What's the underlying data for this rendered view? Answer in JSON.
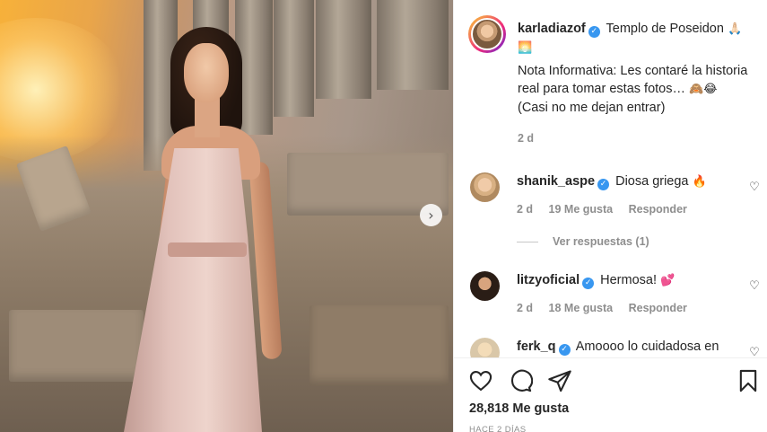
{
  "post": {
    "author": "karladiazof",
    "caption_title": "Templo de Poseidon",
    "caption_title_emoji": "🙏🏻🌅",
    "caption_body": "Nota Informativa: Les contaré la historia real para tomar estas fotos…",
    "caption_body_emoji": "🙈😂",
    "caption_footer": "(Casi no me dejan entrar)",
    "age": "2 d"
  },
  "comments": [
    {
      "author": "shanik_aspe",
      "text": "Diosa griega",
      "emoji": "🔥",
      "age": "2 d",
      "likes": "19 Me gusta",
      "reply_label": "Responder",
      "view_replies": "Ver respuestas (1)"
    },
    {
      "author": "litzyoficial",
      "text": "Hermosa!",
      "emoji": "💕",
      "age": "2 d",
      "likes": "18 Me gusta",
      "reply_label": "Responder"
    },
    {
      "author": "ferk_q",
      "text": "Amoooo lo cuidadosa en"
    }
  ],
  "footer": {
    "likes": "28,818 Me gusta",
    "time_ago": "HACE 2 DÍAS"
  },
  "icons": {
    "verified": "verified-badge-icon",
    "heart": "heart-icon",
    "comment": "comment-icon",
    "share": "share-icon",
    "save": "bookmark-icon",
    "next": "chevron-right-icon"
  },
  "colors": {
    "verified": "#3897f0",
    "muted": "#8e8e8e",
    "text": "#262626"
  }
}
